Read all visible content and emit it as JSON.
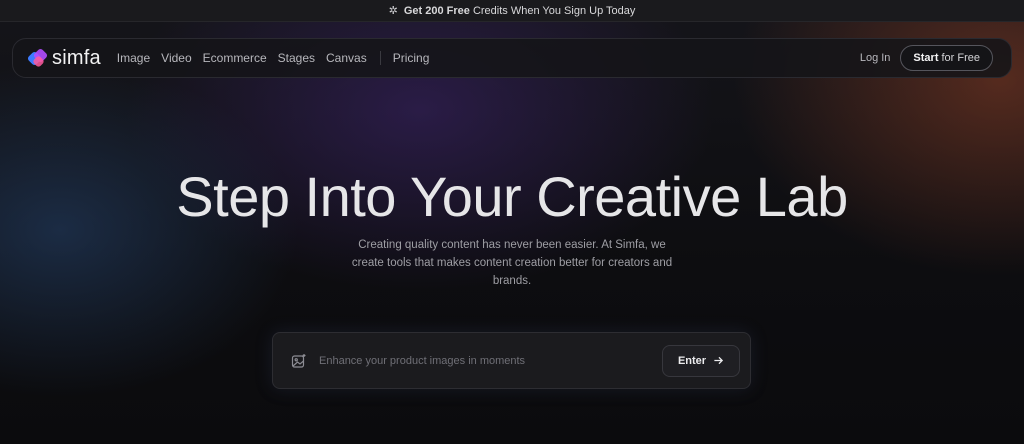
{
  "promo": {
    "icon": "sparkle-icon",
    "prefix": "Get",
    "credits": "200 Free",
    "suffix": "Credits When You Sign Up Today"
  },
  "nav": {
    "logo_text": "simfa",
    "menu": [
      "Image",
      "Video",
      "Ecommerce",
      "Stages",
      "Canvas",
      "Pricing"
    ],
    "login_label": "Log In",
    "start_bold": "Start",
    "start_rest": "for Free"
  },
  "hero": {
    "title": "Step Into Your Creative Lab",
    "subtitle": "Creating quality content has never been easier. At Simfa, we create tools that makes content creation better for creators and brands."
  },
  "prompt": {
    "placeholder": "Enhance your product images in moments",
    "value": "",
    "enter_label": "Enter",
    "icons": [
      "image-sparkle-icon",
      "arrow-right-icon"
    ]
  },
  "colors": {
    "background": "#0c0c0e",
    "glow_blue": "#26446e",
    "glow_purple": "#3e246e",
    "glow_orange": "#8c3e24"
  }
}
